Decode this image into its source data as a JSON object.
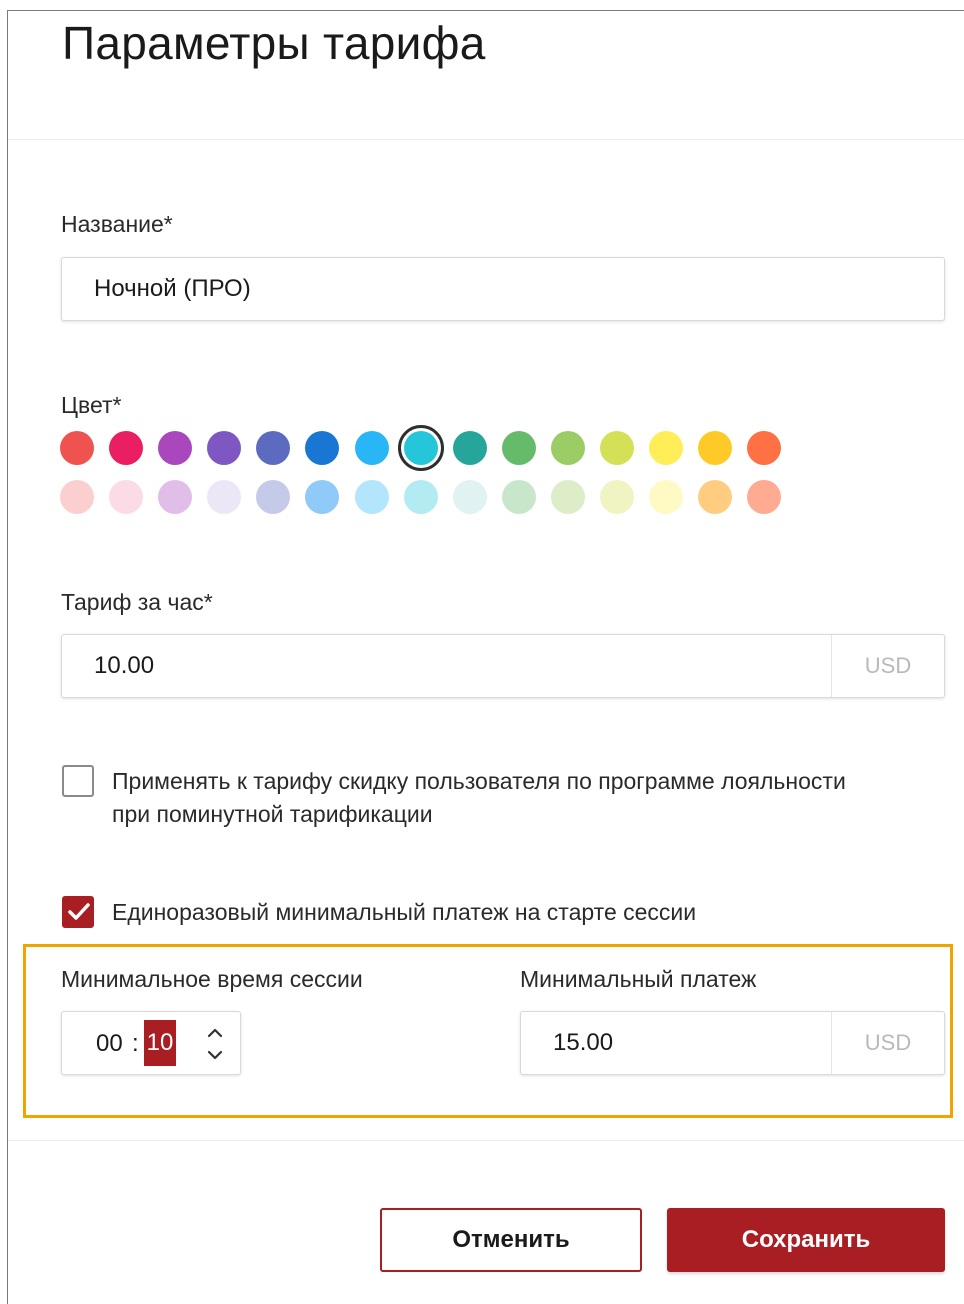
{
  "dialog": {
    "title": "Параметры тарифа"
  },
  "name_field": {
    "label": "Название*",
    "value": "Ночной (ПРО)"
  },
  "color_field": {
    "label": "Цвет*",
    "selected_index": 7,
    "row1": [
      "#ef5350",
      "#e91e63",
      "#ab47bc",
      "#7e57c2",
      "#5c6bc0",
      "#1976d2",
      "#29b6f6",
      "#26c6da",
      "#26a69a",
      "#66bb6a",
      "#9ccc65",
      "#d4e157",
      "#ffee58",
      "#ffca28",
      "#ff7043"
    ],
    "row2": [
      "#fbcfd0",
      "#fbdce6",
      "#e1bee7",
      "#ece7f6",
      "#c5cae9",
      "#90caf9",
      "#b3e5fc",
      "#b2ebf2",
      "#e0f2f1",
      "#c8e6c9",
      "#dcedc8",
      "#f0f4c3",
      "#fff9c4",
      "#ffcc80",
      "#ffab91"
    ]
  },
  "rate_field": {
    "label": "Тариф за час*",
    "value": "10.00",
    "currency": "USD"
  },
  "loyalty_checkbox": {
    "checked": false,
    "text_line1": "Применять к тарифу скидку пользователя по программе лояльности",
    "text_line2": "при поминутной тарификации"
  },
  "min_payment_checkbox": {
    "checked": true,
    "text": "Единоразовый минимальный платеж на старте сессии"
  },
  "min_session_time": {
    "label": "Минимальное время сессии",
    "hours": "00",
    "separator": ":",
    "minutes": "10"
  },
  "min_payment": {
    "label": "Минимальный платеж",
    "value": "15.00",
    "currency": "USD"
  },
  "buttons": {
    "cancel": "Отменить",
    "save": "Сохранить"
  },
  "colors": {
    "accent": "#a91e22",
    "highlight_border": "#f0a400"
  }
}
